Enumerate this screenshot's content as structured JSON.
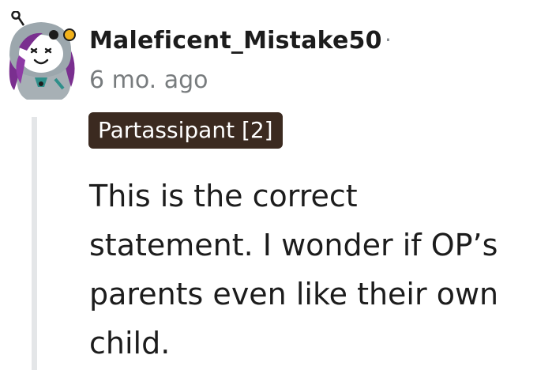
{
  "comment": {
    "username": "Maleficent_Mistake50",
    "separator": "·",
    "timestamp": "6 mo. ago",
    "flair": "Partassipant [2]",
    "body_lines": [
      "This is the correct",
      "statement. I wonder if OP’s",
      "parents even like their own",
      "child."
    ]
  },
  "colors": {
    "flair_bg": "#3b2a20",
    "thread_line": "#e4e6e8",
    "username": "#1c1c1c",
    "timestamp": "#787c7e"
  },
  "icons": {
    "avatar": "snoo-avatar-icon"
  }
}
